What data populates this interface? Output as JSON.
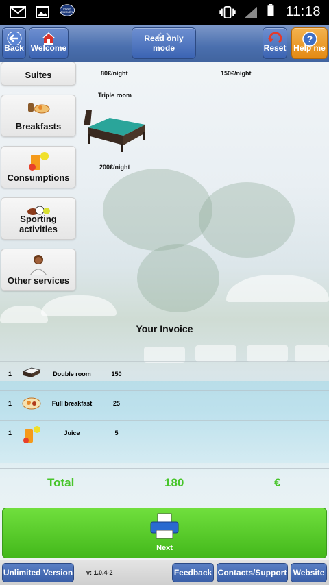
{
  "status_bar": {
    "time": "11:18",
    "icons": [
      "gmail-icon",
      "gallery-icon",
      "hotel-app-icon",
      "vibrate-icon",
      "signal-icon",
      "battery-icon"
    ]
  },
  "toolbar": {
    "back_label": "Back",
    "welcome_label": "Welcome",
    "mode_label": "Read only mode",
    "reset_label": "Reset",
    "help_label": "Help me"
  },
  "categories": [
    {
      "label": "Suites",
      "icon": "suite-icon"
    },
    {
      "label": "Breakfasts",
      "icon": "breakfast-icon"
    },
    {
      "label": "Consumptions",
      "icon": "drinks-icon"
    },
    {
      "label": "Sporting activities",
      "icon": "sports-balls-icon"
    },
    {
      "label": "Other services",
      "icon": "staff-icon"
    }
  ],
  "rooms": [
    {
      "price": "80€/night"
    },
    {
      "price": "150€/night"
    },
    {
      "name": "Triple room",
      "price": "200€/night"
    }
  ],
  "invoice": {
    "title": "Your Invoice",
    "items": [
      {
        "qty": "1",
        "name": "Double room",
        "price": "150",
        "icon": "bed-icon"
      },
      {
        "qty": "1",
        "name": "Full breakfast",
        "price": "25",
        "icon": "breakfast-icon"
      },
      {
        "qty": "1",
        "name": "Juice",
        "price": "5",
        "icon": "juice-icon"
      }
    ],
    "total_label": "Total",
    "total_value": "180",
    "currency": "€"
  },
  "next_label": "Next",
  "footer": {
    "unlimited_label": "Unlimited Version",
    "version": "v: 1.0.4-2",
    "feedback_label": "Feedback",
    "contacts_label": "Contacts/Support",
    "website_label": "Website"
  },
  "colors": {
    "toolbar": "#4a6fae",
    "help": "#e48a14",
    "next": "#4cc526",
    "total": "#47c52a"
  }
}
